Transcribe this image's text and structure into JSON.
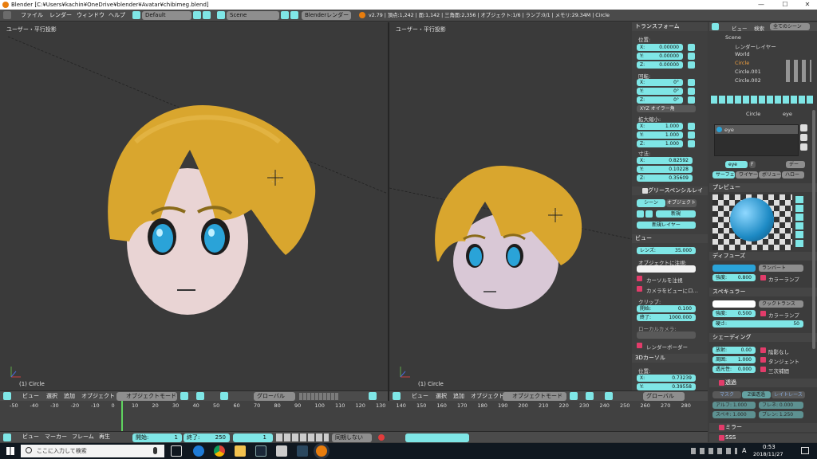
{
  "window": {
    "title": "Blender [C:¥Users¥kachin¥OneDrive¥blender¥Avatar¥chibimeg.blend]",
    "min": "—",
    "max": "☐",
    "close": "✕"
  },
  "topbar": {
    "menus": [
      "ファイル",
      "レンダー",
      "ウィンドウ",
      "ヘルプ"
    ],
    "layout": "Default",
    "scene": "Scene",
    "engine": "Blenderレンダー",
    "stats": "v2.79 | 頂点:1,242 | 面:1,142 | 三角面:2,356 | オブジェクト:1/6 | ランプ:0/1 | メモリ:29.34M | Circle"
  },
  "viewport_left": {
    "label": "ユーザー・平行投影",
    "object": "(1) Circle"
  },
  "viewport_right": {
    "label": "ユーザー・平行投影",
    "object": "(1) Circle"
  },
  "view_header": {
    "menus": [
      "ビュー",
      "選択",
      "追加",
      "オブジェクト"
    ],
    "mode": "オブジェクトモード",
    "orientation": "グローバル"
  },
  "npanel": {
    "transform": "トランスフォーム",
    "location": "位置:",
    "loc": [
      {
        "l": "X:",
        "v": "0.00000"
      },
      {
        "l": "Y:",
        "v": "0.00000"
      },
      {
        "l": "Z:",
        "v": "0.00000"
      }
    ],
    "rotation": "回転:",
    "rot": [
      {
        "l": "X:",
        "v": "0°"
      },
      {
        "l": "Y:",
        "v": "0°"
      },
      {
        "l": "Z:",
        "v": "0°"
      }
    ],
    "rotmode": "XYZ オイラー角",
    "scale": "拡大縮小:",
    "scl": [
      {
        "l": "X:",
        "v": "1.000"
      },
      {
        "l": "Y:",
        "v": "1.000"
      },
      {
        "l": "Z:",
        "v": "1.000"
      }
    ],
    "dimensions": "寸法:",
    "dim": [
      {
        "l": "X:",
        "v": "0.82592"
      },
      {
        "l": "Y:",
        "v": "0.10228"
      },
      {
        "l": "Z:",
        "v": "0.35609"
      }
    ],
    "grease": "グリースペンシルレイ",
    "scene_btn": "シーン",
    "object_btn": "オブジェクト",
    "new_btn": "新規",
    "new_layer": "新規レイヤー",
    "view": "ビュー",
    "lens": "レンズ:",
    "lens_v": "35.000",
    "lock_obj": "オブジェクトに注視:",
    "lock_cursor": "カーソルを注視",
    "lock_camera": "カメラをビューにロ…",
    "clip": "クリップ:",
    "clip_start": "開始:",
    "clip_start_v": "0.100",
    "clip_end": "終了:",
    "clip_end_v": "1000.000",
    "local_cam": "ローカルカメラ:",
    "render_border": "レンダーボーダー",
    "cursor": "3Dカーソル",
    "cursor_loc": "位置:",
    "cur": [
      {
        "l": "X:",
        "v": "0.73239"
      },
      {
        "l": "Y:",
        "v": "0.39558"
      }
    ]
  },
  "outliner": {
    "menus": [
      "ビュー",
      "検索"
    ],
    "filter": "全てのシーン",
    "items": [
      "Scene",
      "レンダーレイヤー",
      "World",
      "Circle",
      "Circle.001",
      "Circle.002"
    ]
  },
  "props": {
    "crumb_obj": "Circle",
    "crumb_mat": "eye",
    "slot": "eye",
    "mat_name": "eye",
    "mat_f": "F",
    "mat_data": "デー",
    "tabs": [
      "サーフェ",
      "ワイヤー",
      "ボリュー",
      "ハロー"
    ],
    "preview": "プレビュー",
    "diffuse": "ディフューズ",
    "diffuse_shader": "ランバート",
    "intensity": "強度:",
    "diffuse_int": "0.800",
    "ramp": "カラーランプ",
    "specular": "スペキュラー",
    "spec_shader": "クックトランス",
    "spec_int": "0.500",
    "spec_ramp": "カラーランプ",
    "hardness": "硬さ:",
    "hardness_v": "50",
    "shading": "シェーディング",
    "emit": "放射:",
    "emit_v": "0.00",
    "shadeless": "陰影なし",
    "ambient": "周囲:",
    "ambient_v": "1.000",
    "tangent": "タンジェント",
    "translucency": "透光性:",
    "translucency_v": "0.000",
    "cubic": "三次補間",
    "transparency": "透過",
    "trans_tabs": [
      "マスク",
      "Z値透過",
      "レイトレース"
    ],
    "alpha": "アルフ: 1.000",
    "fresnel": "フレネ: 0.000",
    "spec_a": "スペキ: 1.000",
    "blend": "ブレン: 1.250",
    "mirror": "ミラー",
    "sss": "SSS"
  },
  "timeline": {
    "ticks": [
      "-50",
      "-40",
      "-30",
      "-20",
      "-10",
      "0",
      "10",
      "20",
      "30",
      "40",
      "50",
      "60",
      "70",
      "80",
      "90",
      "100",
      "110",
      "120",
      "130",
      "140",
      "150",
      "160",
      "170",
      "180",
      "190",
      "200",
      "210",
      "220",
      "230",
      "240",
      "250",
      "260",
      "270",
      "280"
    ],
    "menus": [
      "ビュー",
      "マーカー",
      "フレーム",
      "再生"
    ],
    "start": "開始:",
    "start_v": "1",
    "end": "終了:",
    "end_v": "250",
    "current": "1",
    "sync": "同期しない"
  },
  "taskbar": {
    "search": "ここに入力して検索",
    "time": "0:53",
    "date": "2018/11/27",
    "ime": "A"
  },
  "colors": {
    "accent": "#7fe6e6",
    "hair": "#d9a62e",
    "iris": "#2aa3d8"
  }
}
